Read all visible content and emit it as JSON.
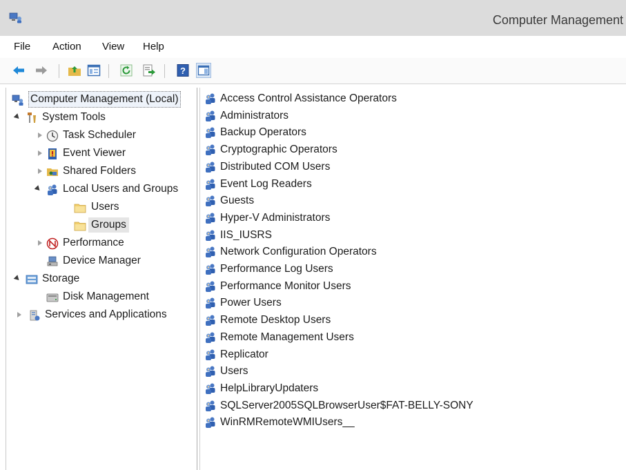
{
  "window": {
    "title": "Computer Management"
  },
  "menu": [
    "File",
    "Action",
    "View",
    "Help"
  ],
  "toolbar": {
    "icons": [
      "back-arrow-icon",
      "forward-arrow-icon",
      "up-folder-icon",
      "show-hide-console-tree-icon",
      "refresh-icon",
      "export-list-icon",
      "help-icon",
      "action-pane-icon"
    ]
  },
  "tree": {
    "root": "Computer Management (Local)",
    "system_tools": "System Tools",
    "task_scheduler": "Task Scheduler",
    "event_viewer": "Event Viewer",
    "shared_folders": "Shared Folders",
    "local_users_groups": "Local Users and Groups",
    "users": "Users",
    "groups": "Groups",
    "performance": "Performance",
    "device_manager": "Device Manager",
    "storage": "Storage",
    "disk_management": "Disk Management",
    "services_apps": "Services and Applications"
  },
  "groups": [
    "Access Control Assistance Operators",
    "Administrators",
    "Backup Operators",
    "Cryptographic Operators",
    "Distributed COM Users",
    "Event Log Readers",
    "Guests",
    "Hyper-V Administrators",
    "IIS_IUSRS",
    "Network Configuration Operators",
    "Performance Log Users",
    "Performance Monitor Users",
    "Power Users",
    "Remote Desktop Users",
    "Remote Management Users",
    "Replicator",
    "Users",
    "HelpLibraryUpdaters",
    "SQLServer2005SQLBrowserUser$FAT-BELLY-SONY",
    "WinRMRemoteWMIUsers__"
  ],
  "colors": {
    "titlebar": "#dcdcdc",
    "selection": "#e5e5e5",
    "folder": "#f5d67a",
    "arrow_blue": "#1e88d8"
  }
}
